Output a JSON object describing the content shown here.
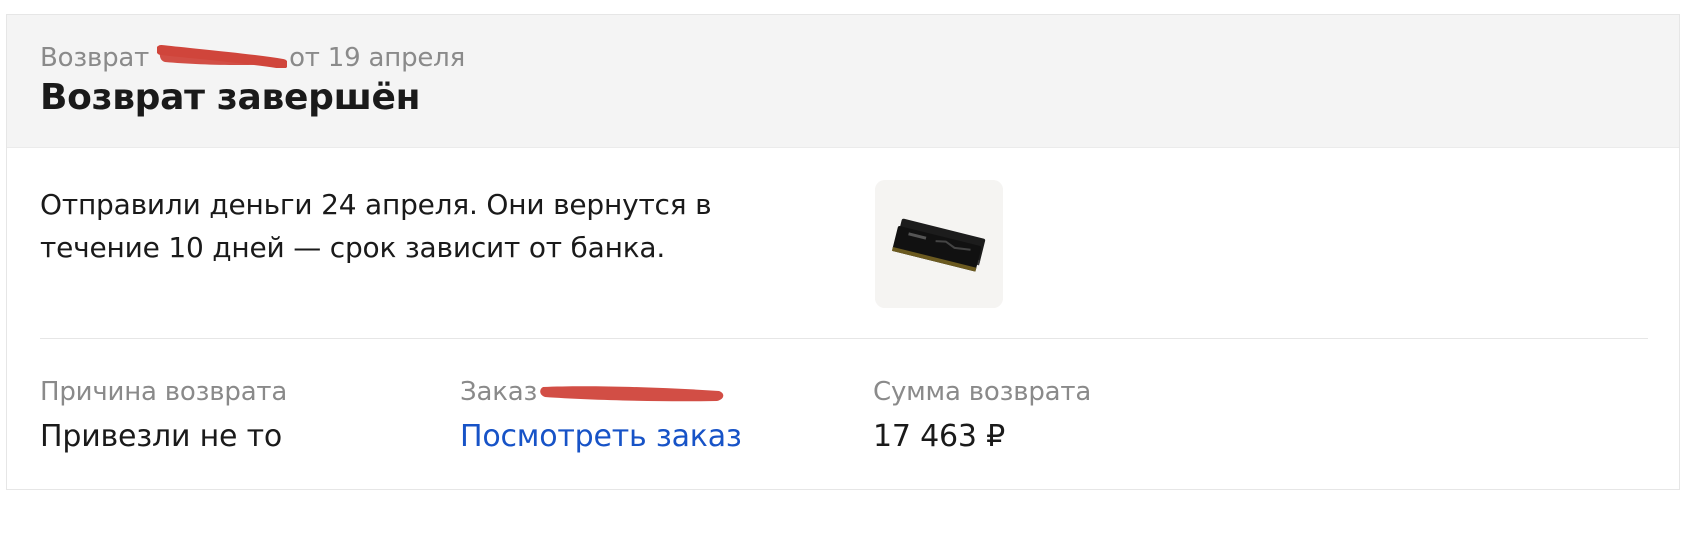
{
  "header": {
    "subtitle_prefix": "Возврат",
    "subtitle_suffix": "от 19 апреля",
    "title": "Возврат завершён"
  },
  "message": "Отправили деньги 24 апреля. Они вернутся в течение 10 дней — срок зависит от банка.",
  "product": {
    "icon": "memory-module-image"
  },
  "details": {
    "reason_label": "Причина возврата",
    "reason_value": "Привезли не то",
    "order_label": "Заказ",
    "order_link": "Посмотреть заказ",
    "amount_label": "Сумма возврата",
    "amount_value": "17 463 ₽"
  },
  "colors": {
    "link": "#1753c7",
    "redaction": "#d0453b",
    "header_bg": "#f4f4f4"
  }
}
